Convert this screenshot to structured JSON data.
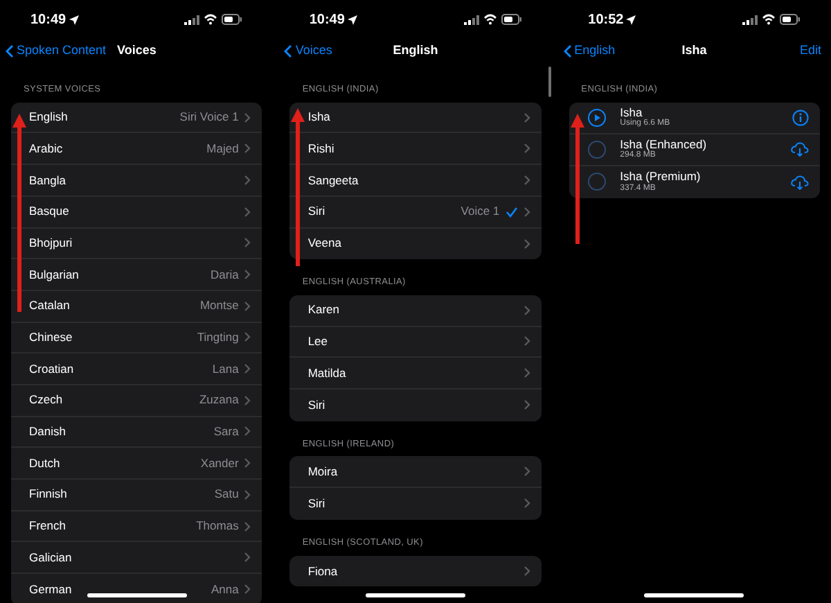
{
  "panels": [
    {
      "status": {
        "time": "10:49"
      },
      "nav": {
        "back": "Spoken Content",
        "title": "Voices"
      },
      "sections": [
        {
          "header": "SYSTEM VOICES",
          "rows": [
            {
              "kind": "link",
              "label": "English",
              "value": "Siri Voice 1"
            },
            {
              "kind": "link",
              "label": "Arabic",
              "value": "Majed"
            },
            {
              "kind": "link",
              "label": "Bangla"
            },
            {
              "kind": "link",
              "label": "Basque"
            },
            {
              "kind": "link",
              "label": "Bhojpuri"
            },
            {
              "kind": "link",
              "label": "Bulgarian",
              "value": "Daria"
            },
            {
              "kind": "link",
              "label": "Catalan",
              "value": "Montse"
            },
            {
              "kind": "link",
              "label": "Chinese",
              "value": "Tingting"
            },
            {
              "kind": "link",
              "label": "Croatian",
              "value": "Lana"
            },
            {
              "kind": "link",
              "label": "Czech",
              "value": "Zuzana"
            },
            {
              "kind": "link",
              "label": "Danish",
              "value": "Sara"
            },
            {
              "kind": "link",
              "label": "Dutch",
              "value": "Xander"
            },
            {
              "kind": "link",
              "label": "Finnish",
              "value": "Satu"
            },
            {
              "kind": "link",
              "label": "French",
              "value": "Thomas"
            },
            {
              "kind": "link",
              "label": "Galician"
            },
            {
              "kind": "link",
              "label": "German",
              "value": "Anna"
            }
          ]
        }
      ]
    },
    {
      "status": {
        "time": "10:49"
      },
      "nav": {
        "back": "Voices",
        "title": "English"
      },
      "sections": [
        {
          "header": "ENGLISH (INDIA)",
          "rows": [
            {
              "kind": "link",
              "label": "Isha",
              "selected": false
            },
            {
              "kind": "link",
              "label": "Rishi",
              "selected": false
            },
            {
              "kind": "link",
              "label": "Sangeeta",
              "selected": false
            },
            {
              "kind": "link",
              "label": "Siri",
              "value": "Voice 1",
              "selected": true
            },
            {
              "kind": "link",
              "label": "Veena",
              "selected": false
            }
          ]
        },
        {
          "header": "ENGLISH (AUSTRALIA)",
          "rows": [
            {
              "kind": "link",
              "label": "Karen",
              "selected": false
            },
            {
              "kind": "link",
              "label": "Lee",
              "selected": false
            },
            {
              "kind": "link",
              "label": "Matilda",
              "selected": false
            },
            {
              "kind": "link",
              "label": "Siri",
              "selected": false
            }
          ]
        },
        {
          "header": "ENGLISH (IRELAND)",
          "rows": [
            {
              "kind": "link",
              "label": "Moira",
              "selected": false
            },
            {
              "kind": "link",
              "label": "Siri",
              "selected": false
            }
          ]
        },
        {
          "header": "ENGLISH (SCOTLAND, UK)",
          "rows": [
            {
              "kind": "link",
              "label": "Fiona",
              "selected": false
            }
          ]
        }
      ]
    },
    {
      "status": {
        "time": "10:52"
      },
      "nav": {
        "back": "English",
        "title": "Isha",
        "action": "Edit"
      },
      "sections": [
        {
          "header": "ENGLISH (INDIA)",
          "rows": [
            {
              "kind": "installed",
              "label": "Isha",
              "detail": "Using 6.6 MB",
              "selected": true
            },
            {
              "kind": "download",
              "label": "Isha (Enhanced)",
              "detail": "294.8 MB",
              "selected": false
            },
            {
              "kind": "download",
              "label": "Isha (Premium)",
              "detail": "337.4 MB",
              "selected": false
            }
          ]
        }
      ]
    }
  ]
}
